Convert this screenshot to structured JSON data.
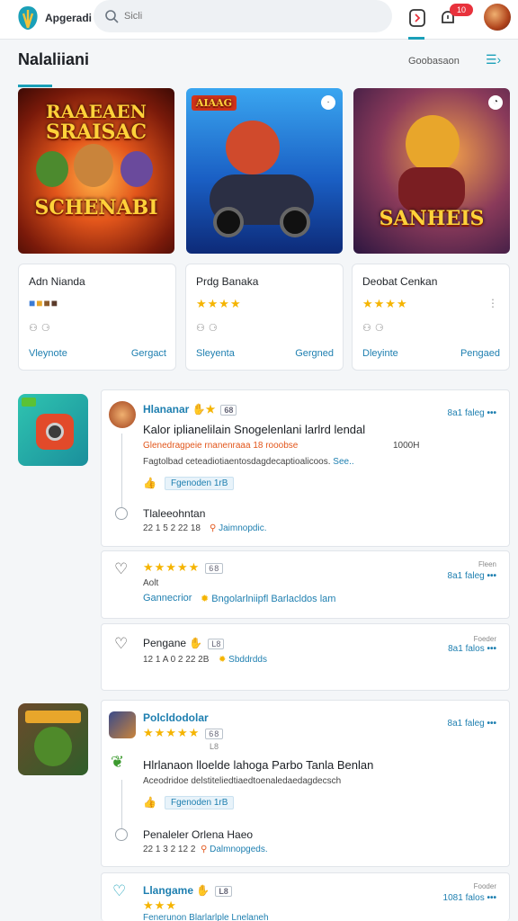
{
  "header": {
    "brand": "Apgeradi",
    "search_placeholder": "Sicli",
    "notif_count": "10"
  },
  "section": {
    "title": "Nalaliiani",
    "link": "Goobasaon"
  },
  "tiles": [
    {
      "title_top": "RAAEAEN",
      "title_mid": "SRAISAC",
      "title_bottom": "SCHENABI"
    },
    {
      "title_top": "AIAAG"
    },
    {
      "title_bottom": "SANHEIS"
    }
  ],
  "cards": [
    {
      "name": "Adn Nianda",
      "left_link": "Vleynote",
      "right_link": "Gergact"
    },
    {
      "name": "Prdg Banaka",
      "left_link": "Sleyenta",
      "right_link": "Gergned"
    },
    {
      "name": "Deobat Cenkan",
      "left_link": "Dleyinte",
      "right_link": "Pengaed"
    }
  ],
  "colors": {
    "accent": "#1aa0b8",
    "link": "#1e7fb0",
    "star": "#f5b400",
    "alert": "#e8323c"
  },
  "feed": {
    "post1": {
      "author": "Hlananar",
      "chip": "68",
      "meta": "8a1 faleg",
      "title": "Kalor iplianelilain Snogelenlani larlrd lendal",
      "orange_line": "Glenedragpeie rnanenraaa 18 rooobse",
      "orange_tail": "1000H",
      "desc": "Fagtolbad ceteadiotiaentosdagdecaptioalicoos.",
      "desc_link": "See..",
      "tag": "Fgenoden 1rB",
      "reply_name": "Tlaleeohntan",
      "reply_time": "22 1 5 2 22 18",
      "reply_link": "Jaimnopdic."
    },
    "post2": {
      "chip": "68",
      "label": "Aolt",
      "meta": "8a1 faleg",
      "meta_small": "Fleen",
      "left": "Gannecrior",
      "right": "Bngolarlniipfl Barlacldos lam"
    },
    "post3": {
      "author": "Pengane",
      "chip": "L8",
      "time": "12 1 A 0 2 22 2B",
      "link": "Sbddrdds",
      "meta": "8a1 falos",
      "meta_small": "Foeder"
    },
    "post4": {
      "author": "Polcldodolar",
      "chip": "68",
      "chip2": "L8",
      "meta": "8a1 faleg",
      "title": "Hlrlanaon lloelde lahoga Parbo Tanla Benlan",
      "desc": "Aceodridoe delstiteliedtiaedtoenaledaedagdecsch",
      "tag": "Fgenoden 1rB",
      "reply_name": "Penaleler Orlena Haeo",
      "reply_time": "22 1 3 2 12 2",
      "reply_link": "Dalmnopgeds."
    },
    "post5": {
      "author": "Llangame",
      "chip": "L8",
      "meta": "1081 falos",
      "meta_small": "Fooder",
      "bottom": "Fenerunon Blarlarlple Lnelaneh"
    }
  }
}
